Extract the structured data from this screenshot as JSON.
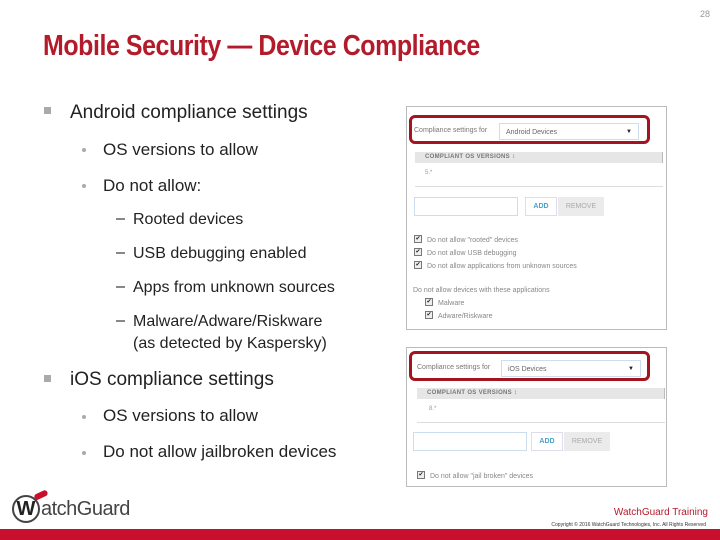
{
  "page_number": "28",
  "title": "Mobile Security — Device Compliance",
  "bullets": {
    "android": {
      "label": "Android compliance settings",
      "items": [
        {
          "label": "OS versions to allow"
        },
        {
          "label": "Do not allow:",
          "subitems": [
            "Rooted devices",
            "USB debugging enabled",
            "Apps from unknown sources",
            "Malware/Adware/Riskware",
            "(as detected by Kaspersky)"
          ]
        }
      ]
    },
    "ios": {
      "label": "iOS compliance settings",
      "items": [
        {
          "label": "OS versions to allow"
        },
        {
          "label": "Do not allow jailbroken devices"
        }
      ]
    }
  },
  "android_panel": {
    "settings_label": "Compliance settings for",
    "selected_device": "Android Devices",
    "caret": "▼",
    "column_header": "COMPLIANT OS VERSIONS ↕",
    "os_value": "5.*",
    "add_label": "ADD",
    "remove_label": "REMOVE",
    "checkboxes": [
      {
        "label": "Do not allow \"rooted\" devices",
        "checked": true
      },
      {
        "label": "Do not allow USB debugging",
        "checked": true
      },
      {
        "label": "Do not allow applications from unknown sources",
        "checked": true
      }
    ],
    "apps_section_label": "Do not allow devices with these applications",
    "app_checkboxes": [
      {
        "label": "Malware",
        "checked": true
      },
      {
        "label": "Adware/Riskware",
        "checked": true
      }
    ]
  },
  "ios_panel": {
    "settings_label": "Compliance settings for",
    "selected_device": "iOS Devices",
    "caret": "▼",
    "column_header": "COMPLIANT OS VERSIONS ↕",
    "os_value": "8.*",
    "add_label": "ADD",
    "remove_label": "REMOVE",
    "checkboxes": [
      {
        "label": "Do not allow \"jail broken\" devices",
        "checked": true
      }
    ]
  },
  "check_glyph": "✔",
  "footer": {
    "logo_mark": "W",
    "logo_text": "atchGuard",
    "training": "WatchGuard Training",
    "copyright": "Copyright © 2016 WatchGuard Technologies, Inc. All Rights Reserved"
  },
  "colors": {
    "brand_red": "#b31b2b",
    "footer_bar": "#c8102e",
    "highlight_border": "#a3141e"
  }
}
